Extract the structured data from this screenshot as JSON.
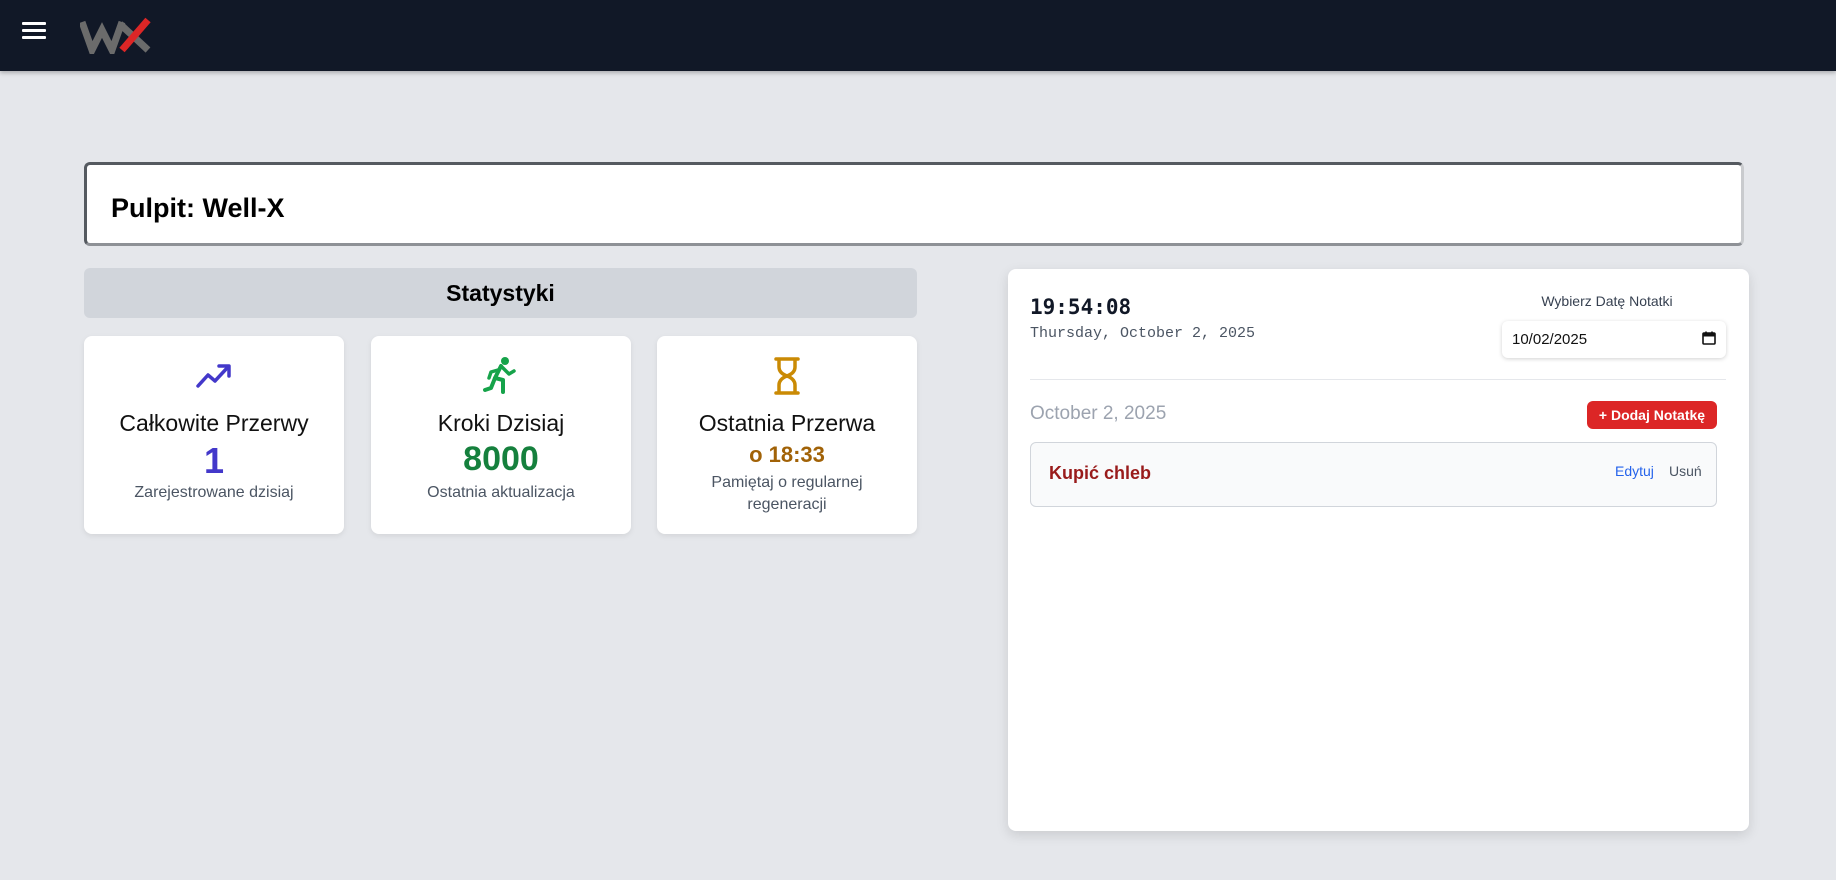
{
  "header": {
    "menu_icon": "hamburger-menu-icon",
    "logo_text": "WX",
    "logo_colors": {
      "w": "#6b6b6b",
      "x": "#dc2626"
    }
  },
  "page": {
    "title": "Pulpit: Well-X"
  },
  "stats": {
    "heading": "Statystyki",
    "cards": [
      {
        "icon": "trending-up-icon",
        "title": "Całkowite Przerwy",
        "value": "1",
        "subtitle": "Zarejestrowane dzisiaj",
        "color": "#4338ca"
      },
      {
        "icon": "running-person-icon",
        "title": "Kroki Dzisiaj",
        "value": "8000",
        "subtitle": "Ostatnia aktualizacja",
        "color": "#15803d"
      },
      {
        "icon": "hourglass-icon",
        "title": "Ostatnia Przerwa",
        "value": "o 18:33",
        "subtitle": "Pamiętaj o regularnej regeneracji",
        "color": "#a16207"
      }
    ]
  },
  "notes_panel": {
    "time": "19:54:08",
    "date_long": "Thursday, October 2, 2025",
    "date_picker_label": "Wybierz Datę Notatki",
    "date_picker_value": "10/02/2025",
    "calendar_icon": "calendar-icon",
    "selected_date": "October 2, 2025",
    "add_button": "+ Dodaj Notatkę",
    "notes": [
      {
        "title": "Kupić chleb",
        "edit_label": "Edytuj",
        "delete_label": "Usuń"
      }
    ]
  }
}
